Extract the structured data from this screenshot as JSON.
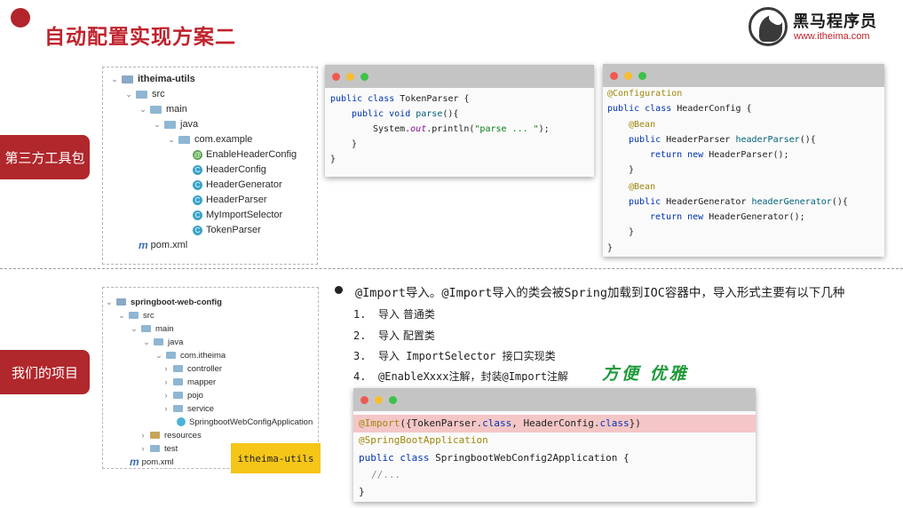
{
  "header": {
    "title": "自动配置实现方案二",
    "logo_cn": "黑马程序员",
    "logo_url": "www.itheima.com"
  },
  "sections": {
    "third_party_label": "第三方工具包",
    "our_project_label": "我们的项目"
  },
  "tree_utils": {
    "nodes": [
      {
        "text": "itheima-utils",
        "kind": "module",
        "chevron": "⌄"
      },
      {
        "text": "src",
        "kind": "folder",
        "chevron": "⌄"
      },
      {
        "text": "main",
        "kind": "folder",
        "chevron": "⌄"
      },
      {
        "text": "java",
        "kind": "folder",
        "chevron": "⌄"
      },
      {
        "text": "com.example",
        "kind": "package",
        "chevron": "⌄"
      },
      {
        "text": "EnableHeaderConfig",
        "kind": "annotation"
      },
      {
        "text": "HeaderConfig",
        "kind": "class"
      },
      {
        "text": "HeaderGenerator",
        "kind": "class"
      },
      {
        "text": "HeaderParser",
        "kind": "class"
      },
      {
        "text": "MyImportSelector",
        "kind": "class"
      },
      {
        "text": "TokenParser",
        "kind": "class"
      },
      {
        "text": "pom.xml",
        "kind": "maven"
      }
    ]
  },
  "tree_project": {
    "nodes": [
      {
        "text": "springboot-web-config",
        "kind": "module",
        "chevron": "⌄"
      },
      {
        "text": "src",
        "kind": "folder",
        "chevron": "⌄"
      },
      {
        "text": "main",
        "kind": "folder",
        "chevron": "⌄"
      },
      {
        "text": "java",
        "kind": "folder",
        "chevron": "⌄"
      },
      {
        "text": "com.itheima",
        "kind": "package",
        "chevron": "⌄"
      },
      {
        "text": "controller",
        "kind": "folder",
        "chevron": "›"
      },
      {
        "text": "mapper",
        "kind": "folder",
        "chevron": "›"
      },
      {
        "text": "pojo",
        "kind": "folder",
        "chevron": "›"
      },
      {
        "text": "service",
        "kind": "folder",
        "chevron": "›"
      },
      {
        "text": "SpringbootWebConfigApplication",
        "kind": "boot"
      },
      {
        "text": "resources",
        "kind": "resources",
        "chevron": "›"
      },
      {
        "text": "test",
        "kind": "folder",
        "chevron": "›"
      },
      {
        "text": "pom.xml",
        "kind": "maven"
      }
    ]
  },
  "code_token_parser": {
    "l1_kw": "public class ",
    "l1_name": "TokenParser {",
    "l2_kw": "public void ",
    "l2_name": "parse",
    "l2_rest": "(){",
    "l3_a": "System.",
    "l3_field": "out",
    "l3_b": ".println(",
    "l3_str": "\"parse ... \"",
    "l3_c": ");",
    "l4": "}",
    "l5": "}"
  },
  "code_header_config": {
    "l1": "@Configuration",
    "l2_kw": "public class ",
    "l2_name": "HeaderConfig {",
    "l3": "@Bean",
    "l4_kw": "public ",
    "l4_type": "HeaderParser ",
    "l4_m": "headerParser",
    "l4_rest": "(){",
    "l5_kw": "return new ",
    "l5_rest": "HeaderParser();",
    "l6": "}",
    "l7": "@Bean",
    "l8_kw": "public ",
    "l8_type": "HeaderGenerator ",
    "l8_m": "headerGenerator",
    "l8_rest": "(){",
    "l9_kw": "return new ",
    "l9_rest": "HeaderGenerator();",
    "l10": "}",
    "l11": "}"
  },
  "bullet": {
    "text": "@Import导入。@Import导入的类会被Spring加载到IOC容器中，导入形式主要有以下几种"
  },
  "list": [
    {
      "num": "1.",
      "text": "导入 普通类"
    },
    {
      "num": "2.",
      "text": "导入 配置类"
    },
    {
      "num": "3.",
      "text": "导入 ImportSelector 接口实现类"
    },
    {
      "num": "4.",
      "text": "@EnableXxxx注解，封装@Import注解"
    }
  ],
  "green_note": "方便 优雅",
  "code_app": {
    "l1_anno": "@Import",
    "l1_a": "({TokenParser.",
    "l1_kw1": "class",
    "l1_b": ", HeaderConfig.",
    "l1_kw2": "class",
    "l1_c": "})",
    "l2": "@SpringBootApplication",
    "l3_kw": "public class ",
    "l3_name": "SpringbootWebConfig2Application {",
    "l4": "//...",
    "l5": "}"
  },
  "yellow_tag": "itheima-utils",
  "colors": {
    "brand_red": "#b0272c",
    "keyword": "#0033b3",
    "annotation": "#9e880d",
    "string": "#067d17",
    "note_green": "#1f9a3a",
    "tag_yellow": "#f5c518"
  }
}
